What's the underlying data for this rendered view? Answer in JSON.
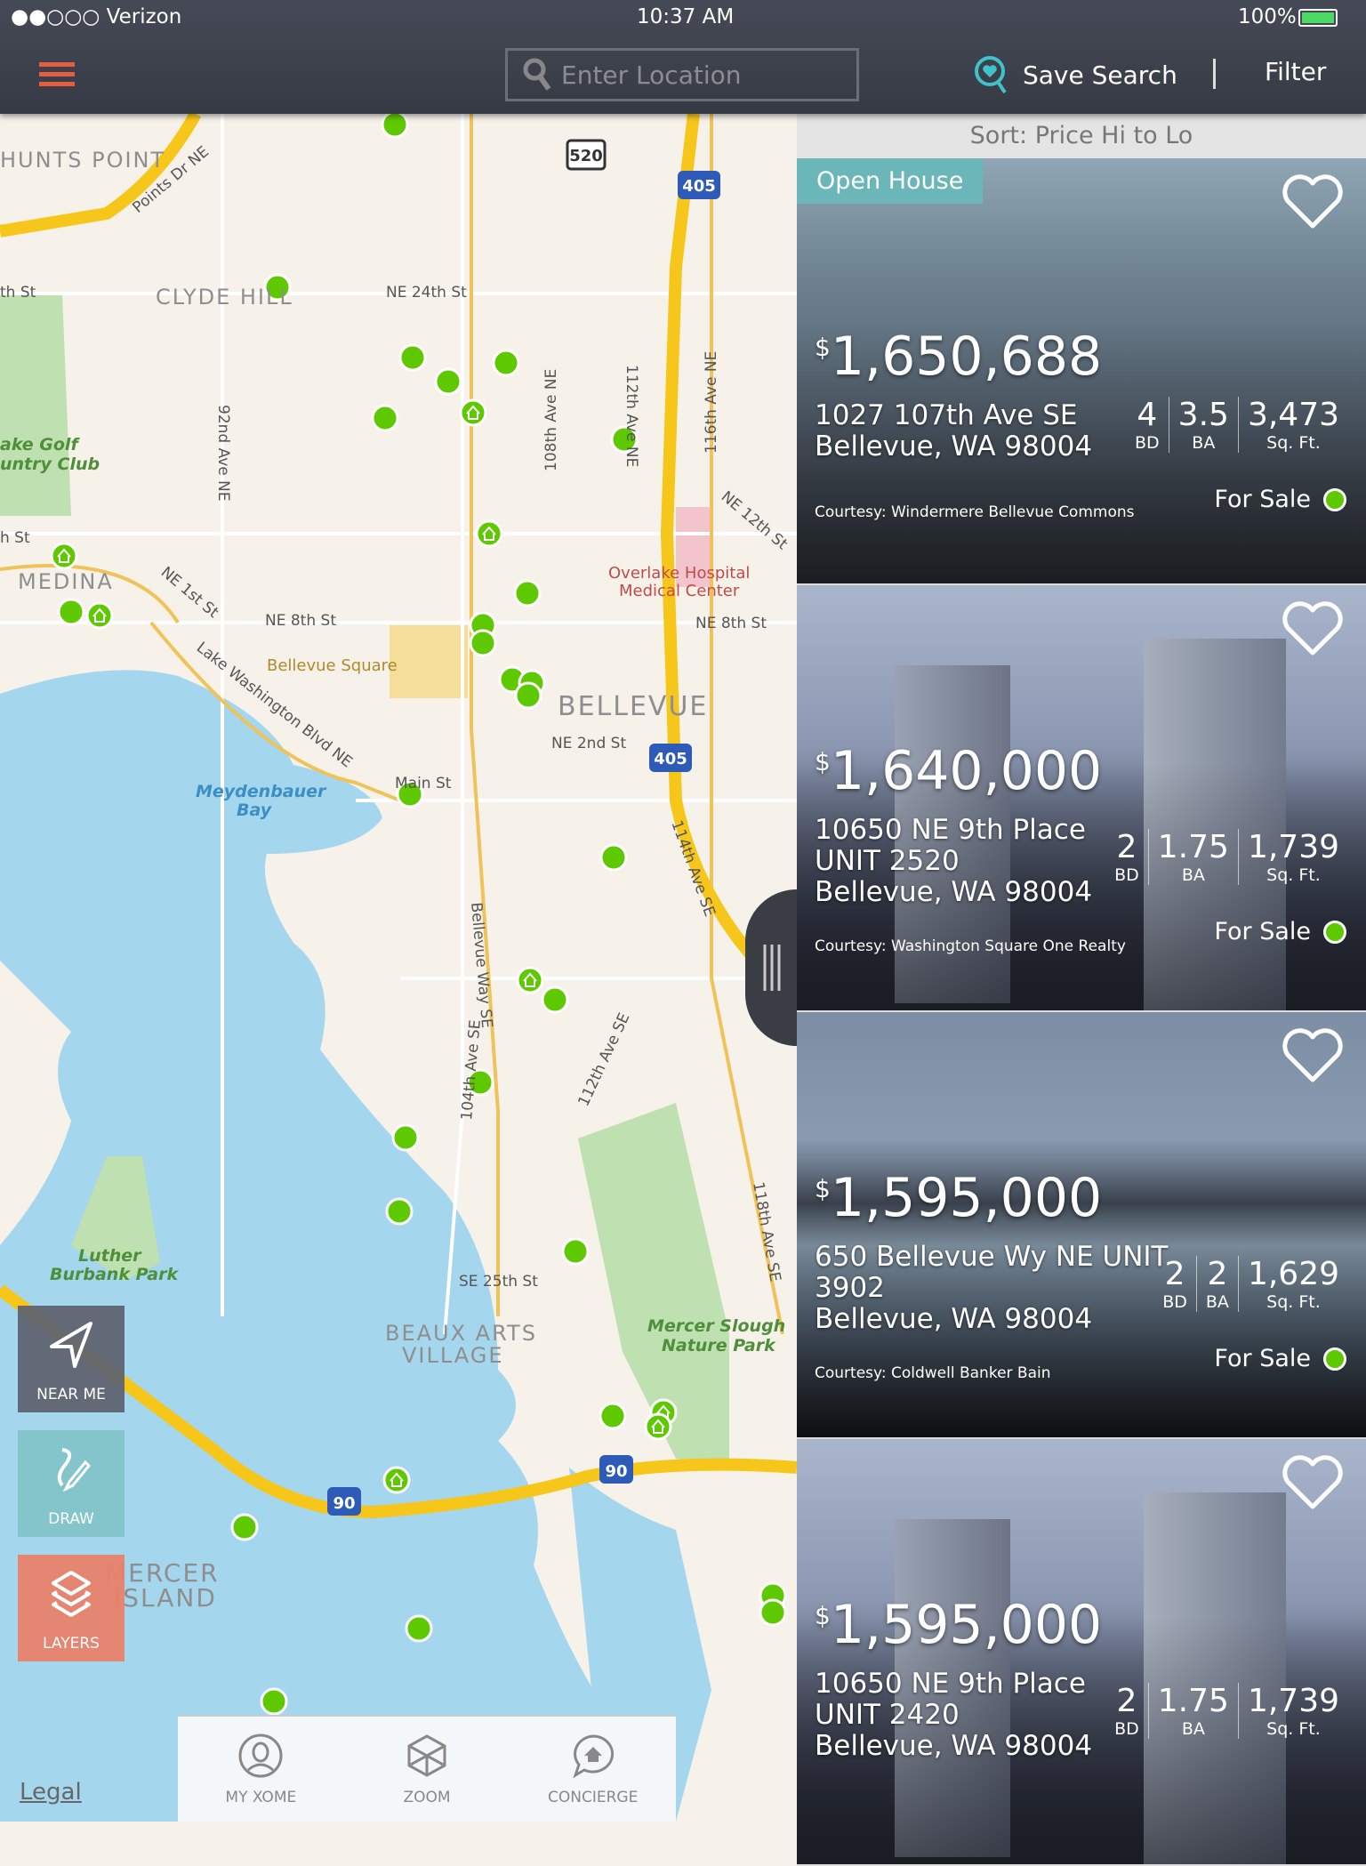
{
  "status_bar": {
    "carrier": "●●○○○ Verizon",
    "time": "10:37 AM",
    "battery": "100%"
  },
  "header": {
    "search_placeholder": "Enter Location",
    "save_search": "Save Search",
    "separator": "|",
    "filter": "Filter"
  },
  "colors": {
    "accent": "#e85c3f",
    "teal": "#3fc2c9",
    "pin": "#5ec800",
    "near_me": "#5f6470",
    "draw": "#7fc3c6",
    "layers": "#e8826a"
  },
  "map": {
    "labels": {
      "hunts_point": "HUNTS POINT",
      "clyde_hill": "CLYDE HILL",
      "medina": "MEDINA",
      "bellevue": "BELLEVUE",
      "beaux_arts": "BEAUX ARTS",
      "village": "VILLAGE",
      "mercer": "MERCER",
      "island": "ISLAND",
      "meydenbauer": "Meydenbauer",
      "bay": "Bay",
      "luther": "Luther",
      "burbank": "Burbank Park",
      "golf": "ake Golf",
      "club": "untry Club",
      "slough": "Mercer Slough",
      "nature": "Nature Park",
      "hospital": "Overlake Hospital",
      "medical": "Medical Center",
      "square": "Bellevue Square"
    },
    "streets": {
      "points": "Points Dr NE",
      "ne24": "NE 24th St",
      "ne8": "NE 8th St",
      "ne8b": "NE 8th St",
      "ne2": "NE 2nd St",
      "ne1": "NE 1st St",
      "ne12": "NE 12th St",
      "lkwa": "Lake Washington Blvd NE",
      "ave92": "92nd Ave NE",
      "ave108": "108th Ave NE",
      "ave112": "112th Ave NE",
      "ave116": "116th Ave NE",
      "ave114": "114th Ave SE",
      "ave118": "118th Ave SE",
      "ave104": "104th Ave SE",
      "bwy": "Bellevue Way SE",
      "ave112se": "112th Ave SE",
      "se25": "SE 25th St",
      "main": "Main St",
      "thst": "th St",
      "st": "h St"
    },
    "shields": {
      "i405": "405",
      "sr520": "520",
      "i90": "90"
    },
    "legal": "Legal"
  },
  "controls": {
    "near_me": "NEAR ME",
    "draw": "DRAW",
    "layers": "LAYERS"
  },
  "tabs": [
    {
      "label": "MY XOME",
      "icon": "user-icon"
    },
    {
      "label": "ZOOM",
      "icon": "cube-icon"
    },
    {
      "label": "CONCIERGE",
      "icon": "chat-home-icon"
    }
  ],
  "listings": {
    "sort": "Sort: Price Hi to Lo",
    "items": [
      {
        "badge": "Open House",
        "price": "1,650,688",
        "address1": "1027 107th Ave SE",
        "address2": "Bellevue, WA 98004",
        "courtesy": "Courtesy: Windermere Bellevue Commons",
        "bd": "4",
        "ba": "3.5",
        "sqft": "3,473",
        "status": "For Sale"
      },
      {
        "price": "1,640,000",
        "address1": "10650 NE 9th Place",
        "address0": "UNIT 2520",
        "address2": "Bellevue, WA 98004",
        "courtesy": "Courtesy: Washington Square One Realty",
        "bd": "2",
        "ba": "1.75",
        "sqft": "1,739",
        "status": "For Sale"
      },
      {
        "price": "1,595,000",
        "address1": "650 Bellevue Wy NE UNIT",
        "address0": "3902",
        "address2": "Bellevue, WA 98004",
        "courtesy": "Courtesy: Coldwell Banker Bain",
        "bd": "2",
        "ba": "2",
        "sqft": "1,629",
        "status": "For Sale"
      },
      {
        "price": "1,595,000",
        "address1": "10650 NE 9th Place",
        "address0": "UNIT 2420",
        "address2": "Bellevue, WA 98004",
        "bd": "2",
        "ba": "1.75",
        "sqft": "1,739"
      }
    ],
    "labels": {
      "dollar": "$",
      "bd": "BD",
      "ba": "BA",
      "sqft": "Sq. Ft."
    }
  }
}
